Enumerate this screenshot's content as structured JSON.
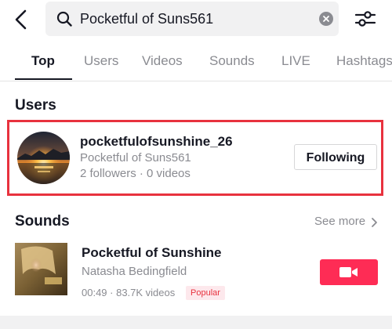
{
  "search": {
    "query": "Pocketful of Suns561"
  },
  "tabs": [
    {
      "label": "Top",
      "active": true
    },
    {
      "label": "Users",
      "active": false
    },
    {
      "label": "Videos",
      "active": false
    },
    {
      "label": "Sounds",
      "active": false
    },
    {
      "label": "LIVE",
      "active": false
    },
    {
      "label": "Hashtags",
      "active": false
    }
  ],
  "users_section": {
    "title": "Users",
    "user": {
      "username": "pocketfulofsunshine_26",
      "nickname": "Pocketful of Suns561",
      "stats": "2 followers · 0 videos",
      "follow_label": "Following"
    }
  },
  "sounds_section": {
    "title": "Sounds",
    "see_more_label": "See more",
    "sound": {
      "title": "Pocketful of Sunshine",
      "artist": "Natasha Bedingfield",
      "meta": "00:49 · 83.7K videos",
      "badge": "Popular"
    }
  },
  "colors": {
    "highlight_border": "#e8323e",
    "accent": "#fe2c55",
    "text_primary": "#161823",
    "text_secondary": "#8a8b91"
  },
  "icons": {
    "back": "chevron-left-icon",
    "search": "search-icon",
    "clear": "clear-icon",
    "filter": "filter-sliders-icon",
    "see_more": "chevron-right-icon",
    "record": "video-camera-icon"
  }
}
